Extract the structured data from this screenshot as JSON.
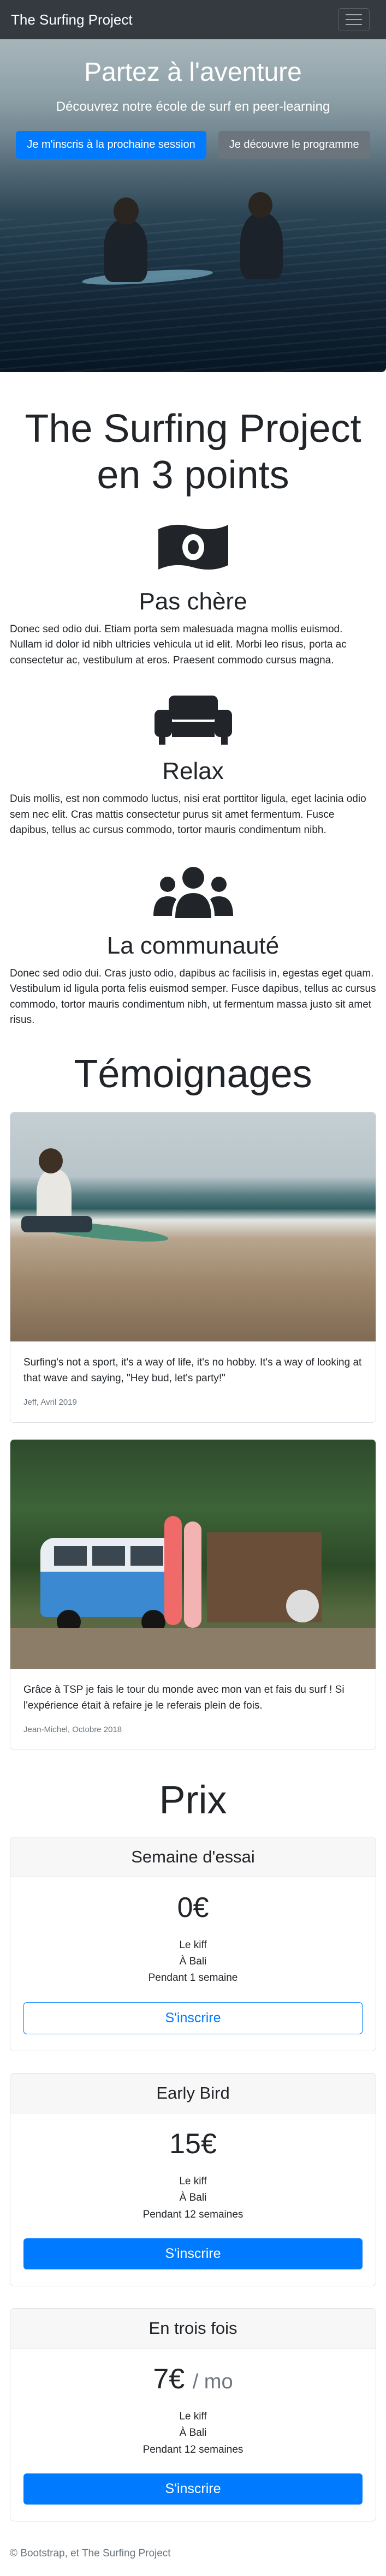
{
  "navbar": {
    "brand": "The Surfing Project",
    "menu_icon": "hamburger-menu-icon"
  },
  "hero": {
    "title": "Partez à l'aventure",
    "lead": "Découvrez notre école de surf en peer-learning",
    "cta_primary": "Je m'inscris à la prochaine session",
    "cta_secondary": "Je découvre le programme"
  },
  "features": {
    "title": "The Surfing Project en 3 points",
    "items": [
      {
        "icon": "money-bill-icon",
        "title": "Pas chère",
        "text": "Donec sed odio dui. Etiam porta sem malesuada magna mollis euismod. Nullam id dolor id nibh ultricies vehicula ut id elit. Morbi leo risus, porta ac consectetur ac, vestibulum at eros. Praesent commodo cursus magna."
      },
      {
        "icon": "couch-icon",
        "title": "Relax",
        "text": "Duis mollis, est non commodo luctus, nisi erat porttitor ligula, eget lacinia odio sem nec elit. Cras mattis consectetur purus sit amet fermentum. Fusce dapibus, tellus ac cursus commodo, tortor mauris condimentum nibh."
      },
      {
        "icon": "users-icon",
        "title": "La communauté",
        "text": "Donec sed odio dui. Cras justo odio, dapibus ac facilisis in, egestas eget quam. Vestibulum id ligula porta felis euismod semper. Fusce dapibus, tellus ac cursus commodo, tortor mauris condimentum nibh, ut fermentum massa justo sit amet risus."
      }
    ]
  },
  "testimonials": {
    "title": "Témoignages",
    "items": [
      {
        "text": "Surfing's not a sport, it's a way of life, it's no hobby. It's a way of looking at that wave and saying, \"Hey bud, let's party!\"",
        "meta": "Jeff, Avril 2019"
      },
      {
        "text": "Grâce à TSP je fais le tour du monde avec mon van et fais du surf ! Si l'expérience était à refaire je le referais plein de fois.",
        "meta": "Jean-Michel, Octobre 2018"
      }
    ]
  },
  "pricing": {
    "title": "Prix",
    "plans": [
      {
        "name": "Semaine d'essai",
        "price": "0€",
        "period": "",
        "features": [
          "Le kiff",
          "À Bali",
          "Pendant 1 semaine"
        ],
        "button": "S'inscrire"
      },
      {
        "name": "Early Bird",
        "price": "15€",
        "period": "",
        "features": [
          "Le kiff",
          "À Bali",
          "Pendant 12 semaines"
        ],
        "button": "S'inscrire"
      },
      {
        "name": "En trois fois",
        "price": "7€",
        "period": "/ mo",
        "features": [
          "Le kiff",
          "À Bali",
          "Pendant 12 semaines"
        ],
        "button": "S'inscrire"
      }
    ]
  },
  "footer": {
    "text": "© Bootstrap, et The Surfing Project"
  },
  "colors": {
    "primary": "#007bff",
    "navbar": "#343a40",
    "muted": "#6c757d"
  }
}
